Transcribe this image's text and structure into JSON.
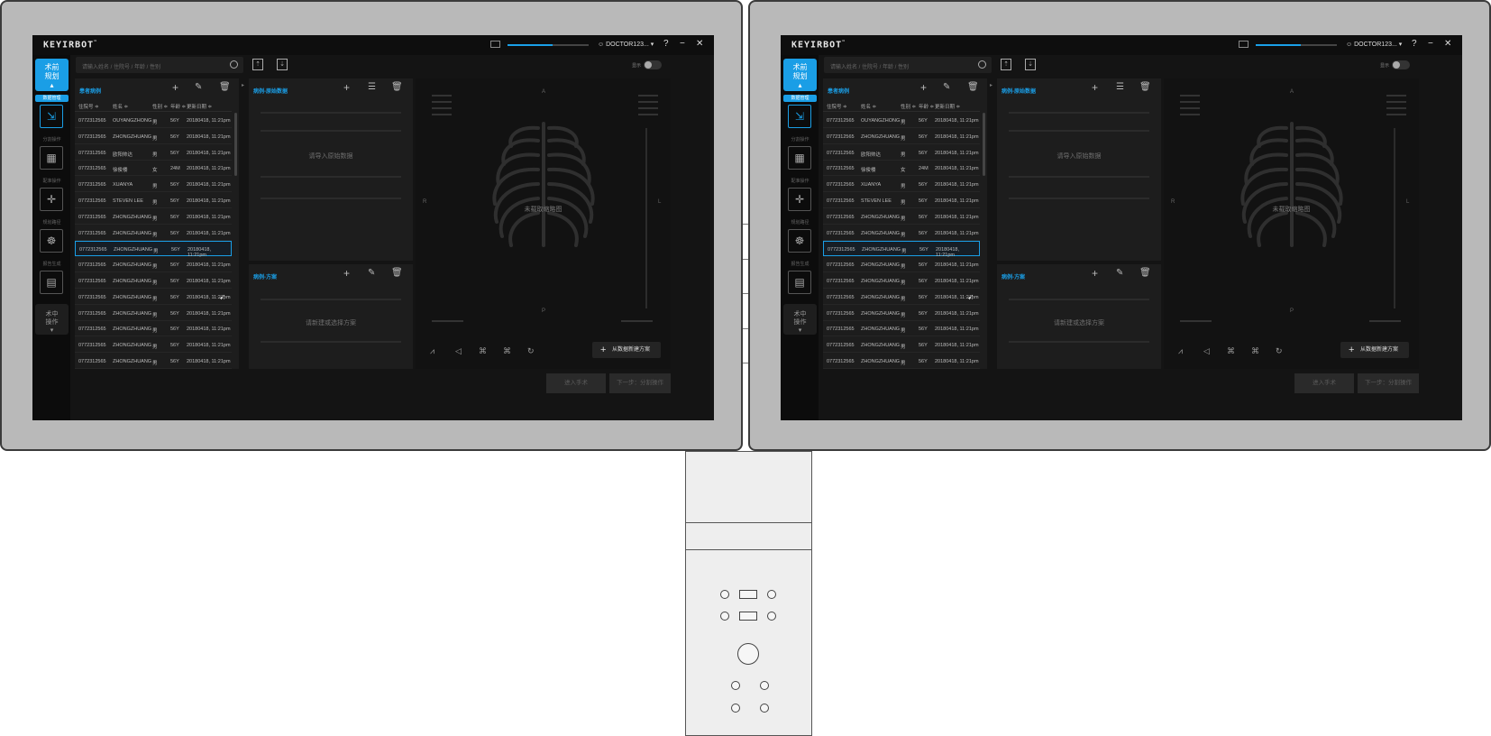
{
  "app": {
    "logo": "KEYIRBOT",
    "logo_mark": "™",
    "user": "DOCTOR123...",
    "help": "?",
    "minimize": "−",
    "close": "✕",
    "volume_level": 0.55
  },
  "nav": {
    "main": "术前\n规划",
    "main_caret": "▴",
    "items": [
      {
        "tag": "数据管理",
        "icon": "file-import-icon",
        "glyph": "⇲"
      },
      {
        "tag": "分割操作",
        "icon": "grid-icon",
        "glyph": "▦"
      },
      {
        "tag": "配准操作",
        "icon": "crosshair-icon",
        "glyph": "✛"
      },
      {
        "tag": "规划路径",
        "icon": "skeleton-icon",
        "glyph": "☸"
      },
      {
        "tag": "报告生成",
        "icon": "report-icon",
        "glyph": "▤"
      }
    ],
    "bottom": "术中\n操作",
    "bottom_caret": "▾"
  },
  "search": {
    "placeholder": "请输入姓名 / 住院号 / 年龄 / 性别"
  },
  "toggle_label": "显示",
  "patients": {
    "title": "患者病例",
    "columns": [
      "住院号 ≑",
      "姓名 ≑",
      "性别 ≑",
      "年龄 ≑",
      "更新日期 ≑"
    ],
    "rows": [
      [
        "0772312565",
        "OUYANGZHONG",
        "男",
        "56Y",
        "20180418, 11:21pm"
      ],
      [
        "0772312565",
        "ZHONGZHUANG",
        "男",
        "56Y",
        "20180418, 11:21pm"
      ],
      [
        "0772312565",
        "欧阳帅达",
        "男",
        "56Y",
        "20180418, 11:21pm"
      ],
      [
        "0772312565",
        "徐俊楼",
        "女",
        "24M",
        "20180418, 11:21pm"
      ],
      [
        "0772312565",
        "XUANYA",
        "男",
        "56Y",
        "20180418, 11:21pm"
      ],
      [
        "0772312565",
        "STEVEN LEE",
        "男",
        "56Y",
        "20180418, 11:21pm"
      ],
      [
        "0772312565",
        "ZHONGZHUANG",
        "男",
        "56Y",
        "20180418, 11:21pm"
      ],
      [
        "0772312565",
        "ZHONGZHUANG",
        "男",
        "56Y",
        "20180418, 11:21pm"
      ],
      [
        "0772312565",
        "ZHONGZHUANG",
        "男",
        "56Y",
        "20180418, 11:21pm"
      ],
      [
        "0772312565",
        "ZHONGZHUANG",
        "男",
        "56Y",
        "20180418, 11:21pm"
      ],
      [
        "0772312565",
        "ZHONGZHUANG",
        "男",
        "56Y",
        "20180418, 11:21pm"
      ],
      [
        "0772312565",
        "ZHONGZHUANG",
        "男",
        "56Y",
        "20180418, 11:21pm"
      ],
      [
        "0772312565",
        "ZHONGZHUANG",
        "男",
        "56Y",
        "20180418, 11:21pm"
      ],
      [
        "0772312565",
        "ZHONGZHUANG",
        "男",
        "56Y",
        "20180418, 11:21pm"
      ],
      [
        "0772312565",
        "ZHONGZHUANG",
        "男",
        "56Y",
        "20180418, 11:21pm"
      ],
      [
        "0772312565",
        "ZHONGZHUANG",
        "男",
        "56Y",
        "20180418, 11:21pm"
      ]
    ],
    "selected_index": 8
  },
  "raw": {
    "title": "病例-原始数据",
    "placeholder": "请导入原始数据"
  },
  "plan": {
    "title": "病例-方案",
    "placeholder": "请新建或选择方案"
  },
  "viewer": {
    "placeholder": "未载取缩略图",
    "orient": {
      "top": "A",
      "bottom": "P",
      "left": "R",
      "right": "L"
    },
    "new_plan": "从数据新建方案"
  },
  "footer": {
    "enter": "进入手术",
    "next": "下一步：分割操作"
  },
  "colors": {
    "accent": "#1a9ee6",
    "bezel": "#b9b9b9",
    "screen": "#141414"
  }
}
